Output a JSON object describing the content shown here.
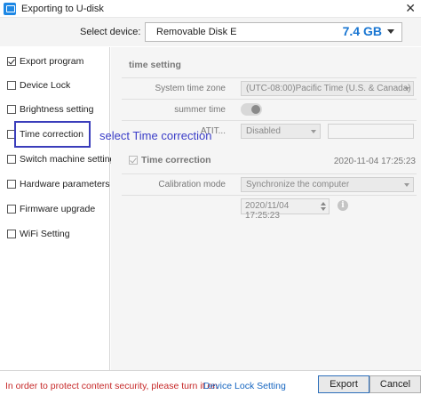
{
  "window": {
    "title": "Exporting to U-disk"
  },
  "device": {
    "label": "Select device:",
    "name": "Removable Disk E",
    "size": "7.4 GB"
  },
  "sidebar": {
    "items": [
      {
        "label": "Export program",
        "checked": true
      },
      {
        "label": "Device Lock",
        "checked": false
      },
      {
        "label": "Brightness setting",
        "checked": false
      },
      {
        "label": "Time correction",
        "checked": false
      },
      {
        "label": "Switch machine settings",
        "checked": false
      },
      {
        "label": "Hardware parameters",
        "checked": false
      },
      {
        "label": "Firmware upgrade",
        "checked": false
      },
      {
        "label": "WiFi Setting",
        "checked": false
      }
    ]
  },
  "annotation": {
    "text": "select Time correction"
  },
  "time_setting": {
    "title": "time setting",
    "timezone_label": "System time zone",
    "timezone_value": "(UTC-08:00)Pacific Time (U.S. & Canada)",
    "summer_label": "summer time",
    "summer_on": true,
    "third_label": "ATIT...",
    "third_value": "Disabled"
  },
  "time_correction": {
    "label": "Time correction",
    "checked": true,
    "current_time": "2020-11-04 17:25:23",
    "mode_label": "Calibration mode",
    "mode_value": "Synchronize the computer",
    "datetime_value": "2020/11/04 17:25:23",
    "info_icon": "info-icon"
  },
  "footer": {
    "message": "In order to protect content security, please turn it on",
    "link": "Device Lock Setting",
    "export_label": "Export",
    "cancel_label": "Cancel"
  },
  "colors": {
    "accent": "#1976d2",
    "annotation": "#3a3dc8",
    "warning": "#c62828"
  }
}
